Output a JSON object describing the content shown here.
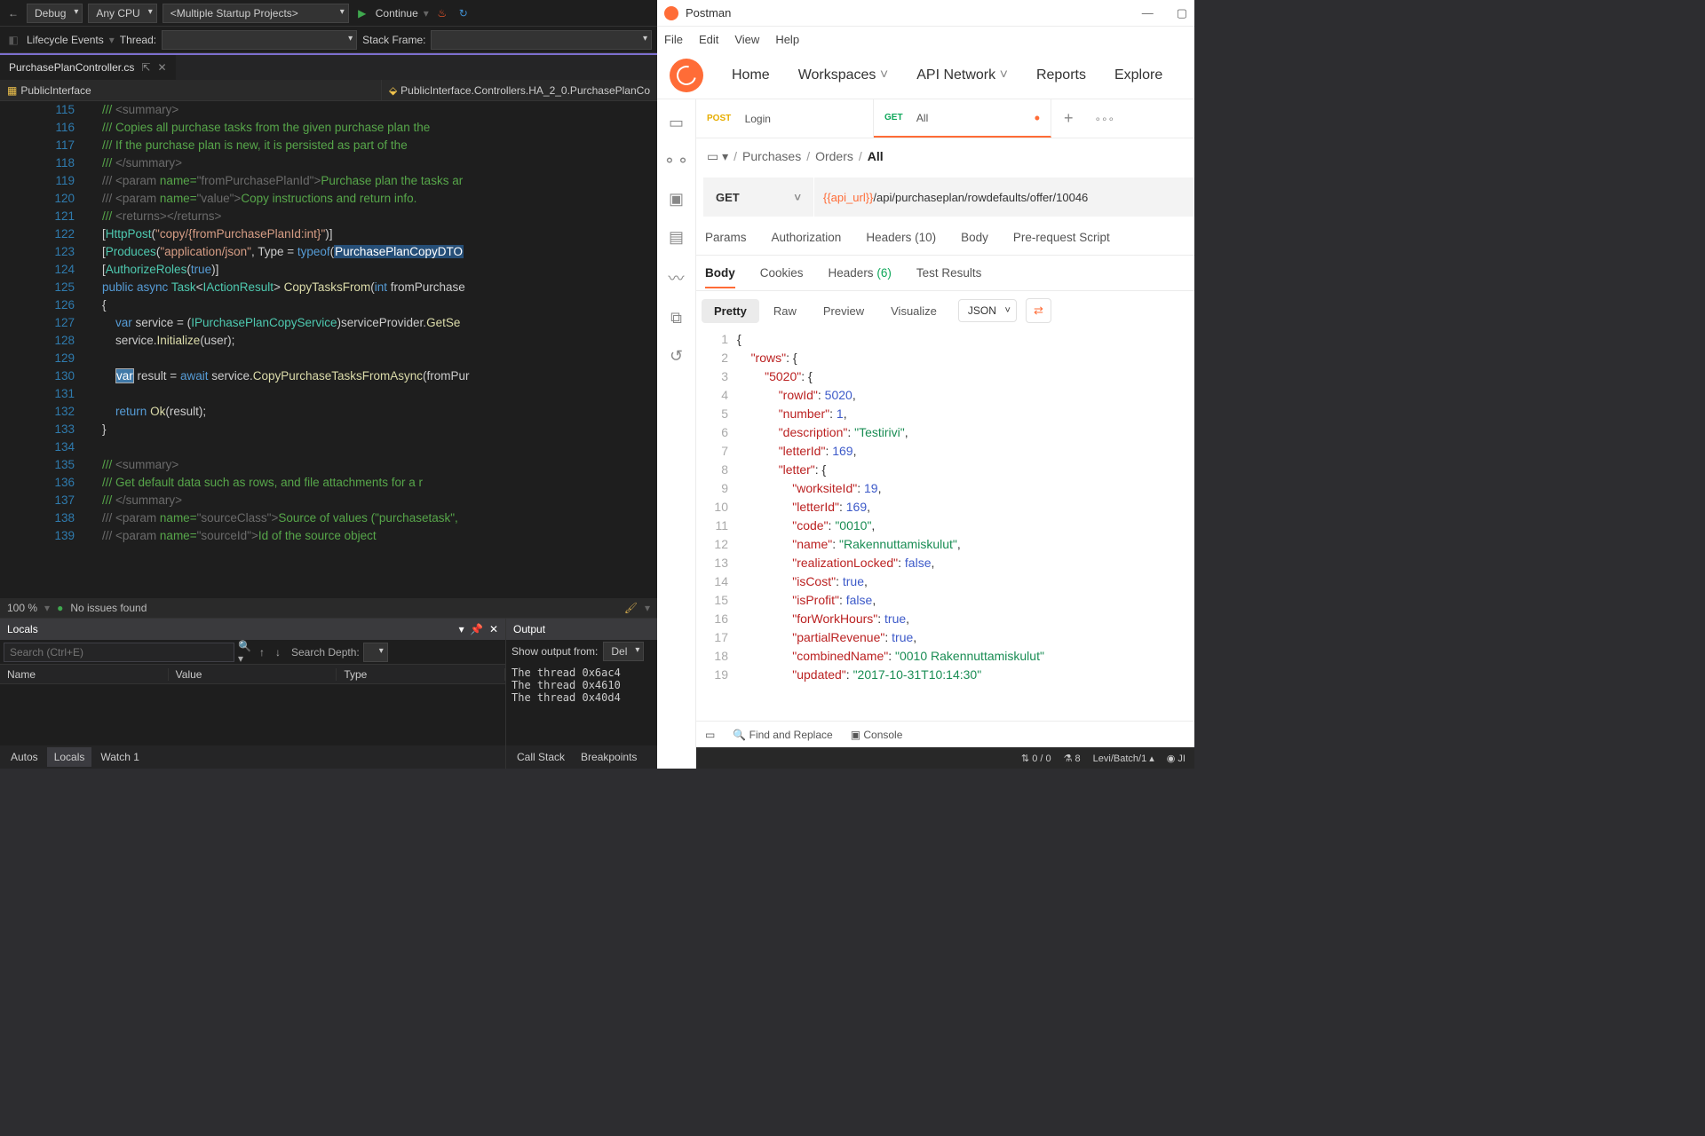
{
  "vs": {
    "toolbar1": {
      "config": "Debug",
      "platform": "Any CPU",
      "startup": "<Multiple Startup Projects>",
      "continue": "Continue"
    },
    "toolbar2": {
      "lifecycle": "Lifecycle Events",
      "thread_lbl": "Thread:",
      "stack_lbl": "Stack Frame:"
    },
    "tab": "PurchasePlanController.cs",
    "navbar": {
      "left": "PublicInterface",
      "right": "PublicInterface.Controllers.HA_2_0.PurchasePlanCo"
    },
    "code": {
      "start": 115,
      "lines": [
        {
          "t": "cmt",
          "txt": "/// <summary>"
        },
        {
          "t": "cmt",
          "txt": "/// Copies all purchase tasks from the given purchase plan the"
        },
        {
          "t": "cmt",
          "txt": "/// If the purchase plan is new, it is persisted as part of the"
        },
        {
          "t": "cmt",
          "txt": "/// </summary>"
        },
        {
          "t": "param",
          "name": "fromPurchasePlanId",
          "txt": "Purchase plan the tasks ar"
        },
        {
          "t": "param",
          "name": "value",
          "txt": "Copy instructions and return info.</par"
        },
        {
          "t": "cmt",
          "txt": "/// <returns></returns>"
        },
        {
          "t": "attr1"
        },
        {
          "t": "attr2"
        },
        {
          "t": "attr3"
        },
        {
          "t": "method"
        },
        {
          "t": "raw",
          "txt": "{"
        },
        {
          "t": "line128"
        },
        {
          "t": "line129"
        },
        {
          "t": "blank"
        },
        {
          "t": "line131"
        },
        {
          "t": "blank"
        },
        {
          "t": "line133"
        },
        {
          "t": "raw",
          "txt": "}"
        },
        {
          "t": "blankout"
        },
        {
          "t": "cmt",
          "txt": "/// <summary>"
        },
        {
          "t": "cmt",
          "txt": "/// Get default data such as rows, and file attachments for a r"
        },
        {
          "t": "cmt",
          "txt": "/// </summary>"
        },
        {
          "t": "param",
          "name": "sourceClass",
          "txt": "Source of values (\"purchasetask\","
        },
        {
          "t": "param",
          "name": "sourceId",
          "txt": "Id of the source object</param>"
        }
      ]
    },
    "statusline": {
      "zoom": "100 %",
      "issues": "No issues found"
    },
    "locals": {
      "title": "Locals",
      "search_ph": "Search (Ctrl+E)",
      "depth_lbl": "Search Depth:",
      "cols": [
        "Name",
        "Value",
        "Type"
      ]
    },
    "output": {
      "title": "Output",
      "from_lbl": "Show output from:",
      "from_val": "Del",
      "lines": [
        "The thread 0x6ac4",
        "The thread 0x4610",
        "The thread 0x40d4"
      ]
    },
    "footerTabs": [
      "Autos",
      "Locals",
      "Watch 1"
    ],
    "footerTabs2": [
      "Call Stack",
      "Breakpoints"
    ]
  },
  "pm": {
    "title": "Postman",
    "menu": [
      "File",
      "Edit",
      "View",
      "Help"
    ],
    "nav": [
      "Home",
      "Workspaces",
      "API Network",
      "Reports",
      "Explore"
    ],
    "tabs": [
      {
        "method": "POST",
        "label": "Login",
        "mcolor": "#e6ad00",
        "active": false,
        "dirty": false
      },
      {
        "method": "GET",
        "label": "All",
        "mcolor": "#0ea75a",
        "active": true,
        "dirty": true
      }
    ],
    "crumbs": [
      "Purchases",
      "Orders",
      "All"
    ],
    "request": {
      "method": "GET",
      "url_var": "{{api_url}}",
      "url_rest": "/api/purchaseplan/rowdefaults/offer/10046"
    },
    "maintabs": [
      "Params",
      "Authorization",
      "Headers (10)",
      "Body",
      "Pre-request Script"
    ],
    "restabs": [
      {
        "l": "Body",
        "a": true
      },
      {
        "l": "Cookies",
        "a": false
      },
      {
        "l": "Headers",
        "c": "(6)"
      },
      {
        "l": "Test Results",
        "a": false
      }
    ],
    "view": {
      "modes": [
        "Pretty",
        "Raw",
        "Preview",
        "Visualize"
      ],
      "active": "Pretty",
      "fmt": "JSON"
    },
    "json_lines": [
      "{",
      "    \"rows\": {",
      "        \"5020\": {",
      "            \"rowId\": 5020,",
      "            \"number\": 1,",
      "            \"description\": \"Testirivi\",",
      "            \"letterId\": 169,",
      "            \"letter\": {",
      "                \"worksiteId\": 19,",
      "                \"letterId\": 169,",
      "                \"code\": \"0010\",",
      "                \"name\": \"Rakennuttamiskulut\",",
      "                \"realizationLocked\": false,",
      "                \"isCost\": true,",
      "                \"isProfit\": false,",
      "                \"forWorkHours\": true,",
      "                \"partialRevenue\": true,",
      "                \"combinedName\": \"0010 Rakennuttamiskulut\"",
      "                \"updated\": \"2017-10-31T10:14:30\""
    ],
    "footer": {
      "find": "Find and Replace",
      "console": "Console"
    },
    "status": {
      "errs": "0 / 0",
      "num": "8",
      "branch": "Levi/Batch/1"
    }
  }
}
